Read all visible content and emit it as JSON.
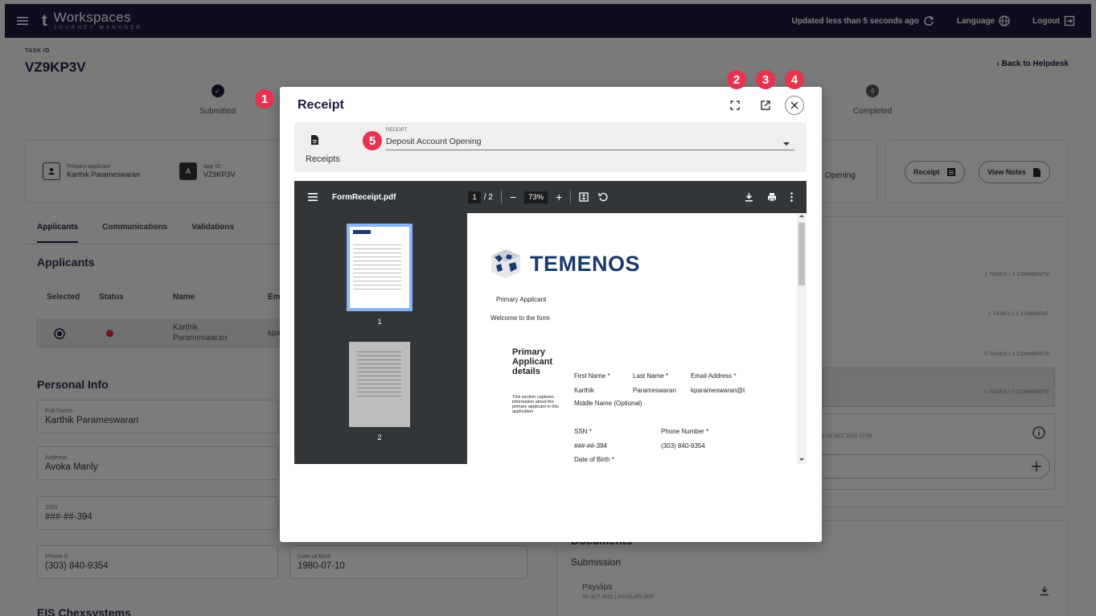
{
  "topbar": {
    "logo_letter": "t",
    "logo_main": "Workspaces",
    "logo_sub": "JOURNEY MANAGER",
    "updated": "Updated less than 5 seconds ago",
    "language": "Language",
    "logout": "Logout"
  },
  "header": {
    "task_label": "TASK ID",
    "task_id": "VZ9KP3V",
    "back_link": "Back to Helpdesk"
  },
  "steps": {
    "submitted": "Submitted",
    "completed": "Completed",
    "completed_num": "6"
  },
  "info_card": {
    "applicant_label": "Primary applicant",
    "applicant_value": "Karthik Parameswaran",
    "appid_icon": "A",
    "appid_label": "App ID",
    "appid_value": "VZ9KP3V",
    "product_partial": "Opening",
    "receipt_btn": "Receipt",
    "notes_btn": "View Notes"
  },
  "tabs": [
    "Applicants",
    "Communications",
    "Validations"
  ],
  "applicants": {
    "title": "Applicants",
    "columns": [
      "Selected",
      "Status",
      "Name",
      "Em"
    ],
    "row": {
      "name": "Karthik Parameswaran",
      "email": "kpa"
    }
  },
  "personal_info": {
    "title": "Personal Info",
    "fields": [
      {
        "label": "Full Name",
        "value": "Karthik Parameswaran"
      },
      {
        "label": "Address",
        "value": "Avoka Manly"
      },
      {
        "label": "SSN",
        "value": "###-##-394"
      },
      {
        "label": "Phone #",
        "value": "(303) 840-9354"
      },
      {
        "label": "Date of Birth",
        "value": "1980-07-10"
      }
    ],
    "next_section": "EIS Chexsystems"
  },
  "right_panel": {
    "counts": [
      "1 TASKS | 0 COMMENTS",
      "1 TASKS | 1 COMMENT",
      "0 TASKS | 0 COMMENTS",
      "1 TASKS | 0 COMMENTS"
    ],
    "date_partial": "D 26 OCT 2022 17:05"
  },
  "documents": {
    "title": "Documents",
    "submission": "Submission",
    "file_name": "Payslips",
    "file_meta": "26 OCT 2022 | PAYSLIPS.PDF"
  },
  "modal": {
    "title": "Receipt",
    "receipts_label": "Receipts",
    "select_label": "RECEIPT",
    "select_value": "Deposit Account Opening"
  },
  "pdf": {
    "file_name": "FormReceipt.pdf",
    "page_current": "1",
    "page_total": "/ 2",
    "zoom": "73%",
    "thumb1": "1",
    "thumb2": "2"
  },
  "doc": {
    "brand": "TEMENOS",
    "primary_applicant": "Primary Applicant",
    "welcome": "Welcome to the form",
    "section_title": "Primary Applicant details",
    "section_desc": "This section captures information about the primary applicant in this application",
    "first_name_lbl": "First Name *",
    "last_name_lbl": "Last Name *",
    "email_lbl": "Email Address *",
    "first_name": "Karthik",
    "last_name": "Parameswaran",
    "email": "kparameswaran@t",
    "middle_name_lbl": "Middle Name (Optional)",
    "ssn_lbl": "SSN *",
    "phone_lbl": "Phone Number *",
    "ssn": "###-##-394",
    "phone": "(303) 840-9354",
    "dob_lbl": "Date of Birth *"
  },
  "badges": [
    "1",
    "2",
    "3",
    "4",
    "5"
  ],
  "colors": {
    "navy": "#1a1b3f",
    "badge": "#e8334f",
    "status_red": "#d32f2f"
  }
}
